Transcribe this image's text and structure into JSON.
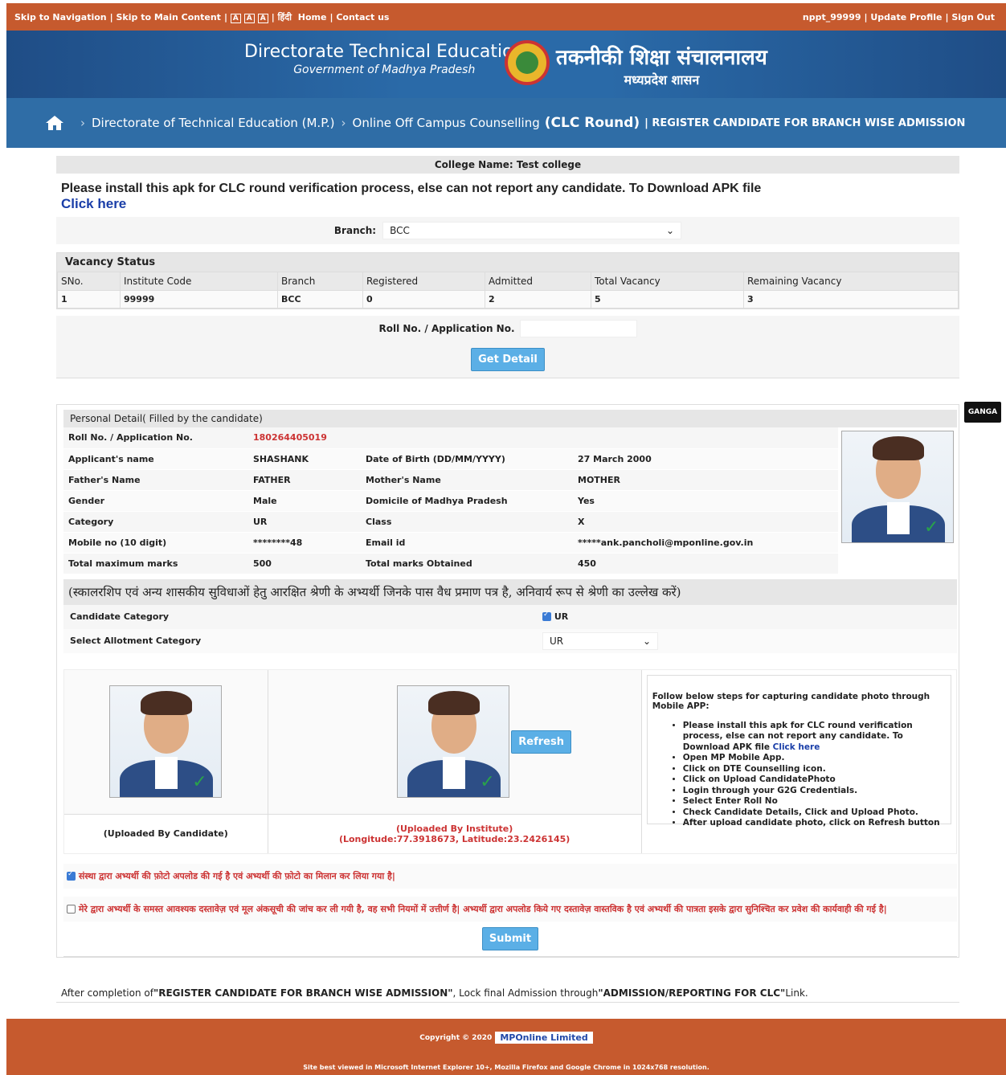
{
  "topbar": {
    "skip_nav": "Skip to Navigation",
    "skip_main": "Skip to Main Content",
    "font_a1": "A",
    "font_a2": "A",
    "font_a3": "A",
    "hindi": "हिंदी",
    "home": "Home",
    "contact": "Contact us",
    "user": "nppt_99999",
    "update_profile": "Update Profile",
    "sign_out": "Sign Out"
  },
  "banner": {
    "title_en": "Directorate Technical Education",
    "subtitle_en": "Government of Madhya Pradesh",
    "title_hi": "तकनीकी शिक्षा संचालनालय",
    "subtitle_hi": "मध्यप्रदेश शासन"
  },
  "breadcrumb": {
    "item1": "Directorate of Technical Education (M.P.)",
    "item2": "Online Off Campus Counselling",
    "round": "(CLC Round)",
    "page": "| REGISTER CANDIDATE FOR BRANCH WISE ADMISSION"
  },
  "college": {
    "label": "College Name: Test college"
  },
  "notice": {
    "text": "Please install this apk for CLC round verification process, else can not report any candidate. To Download APK file",
    "link": "Click here"
  },
  "branch": {
    "label": "Branch:",
    "value": "BCC"
  },
  "vacancy": {
    "title": "Vacancy Status",
    "headers": [
      "SNo.",
      "Institute Code",
      "Branch",
      "Registered",
      "Admitted",
      "Total Vacancy",
      "Remaining Vacancy"
    ],
    "row": [
      "1",
      "99999",
      "BCC",
      "0",
      "2",
      "5",
      "3"
    ]
  },
  "roll": {
    "label": "Roll No. / Application No.",
    "button": "Get Detail"
  },
  "personal": {
    "title": "Personal Detail( Filled by the candidate)",
    "roll_label": "Roll No. / Application No.",
    "roll_value": "180264405019",
    "name_label": "Applicant's name",
    "name_value": "SHASHANK",
    "dob_label": "Date of Birth (DD/MM/YYYY)",
    "dob_value": "27 March 2000",
    "father_label": "Father's Name",
    "father_value": "FATHER",
    "mother_label": "Mother's Name",
    "mother_value": "MOTHER",
    "gender_label": "Gender",
    "gender_value": "Male",
    "domicile_label": "Domicile of Madhya Pradesh",
    "domicile_value": "Yes",
    "category_label": "Category",
    "category_value": "UR",
    "class_label": "Class",
    "class_value": "X",
    "mobile_label": "Mobile no (10 digit)",
    "mobile_value": "********48",
    "email_label": "Email id",
    "email_value": "*****ank.pancholi@mponline.gov.in",
    "maxmarks_label": "Total maximum marks",
    "maxmarks_value": "500",
    "obtained_label": "Total marks Obtained",
    "obtained_value": "450"
  },
  "category_section": {
    "hindi_note": "(स्कालरशिप एवं अन्य शासकीय सुविधाओं हेतु आरक्षित श्रेणी के अभ्यर्थी जिनके पास वैध प्रमाण पत्र है, अनिवार्य रूप से श्रेणी का उल्लेख करें)",
    "candidate_category_label": "Candidate Category",
    "candidate_category_value": "UR",
    "allotment_label": "Select Allotment Category",
    "allotment_value": "UR"
  },
  "photos": {
    "candidate_caption": "(Uploaded By Candidate)",
    "refresh": "Refresh",
    "institute_caption": "(Uploaded By Institute)",
    "coords": "(Longitude:77.3918673, Latitude:23.2426145)",
    "steps_title": "Follow below steps for capturing candidate photo through Mobile APP:",
    "step1": "Please install this apk for CLC round verification process, else can not report any candidate. To Download APK file",
    "step1_link": "Click here",
    "steps": [
      "Open MP Mobile App.",
      "Click on DTE Counselling icon.",
      "Click on Upload CandidatePhoto",
      "Login through your G2G Credentials.",
      "Select Enter Roll No",
      "Check Candidate Details, Click and Upload Photo.",
      "After upload candidate photo, click on Refresh button"
    ]
  },
  "declaration": {
    "line1": "संस्था द्वारा अभ्यर्थी की फ़ोटो अपलोड की गई है एवं अभ्यर्थी की फ़ोटो का मिलान कर लिया गया है|",
    "line2": "मेरे द्वारा अभ्यर्थी के समस्त आवश्यक दस्तावेज़ एवं मूल अंकसूची की जांच कर ली गयी है, वह सभी नियमों में उत्तीर्ण है| अभ्यर्थी द्वारा अपलोड किये गए दस्तावेज़ वास्तविक है एवं अभ्यर्थी की पात्रता इसके द्वारा सुनिश्चित कर प्रवेश की कार्यवाही की गई है|",
    "submit": "Submit"
  },
  "after_note": {
    "p1": "After completion of ",
    "q1": "\"REGISTER CANDIDATE FOR BRANCH WISE ADMISSION\"",
    "p2": ", Lock final Admission through ",
    "q2": "\"ADMISSION/REPORTING FOR CLC\"",
    "p3": " Link."
  },
  "footer": {
    "copyright": "Copyright © 2020",
    "logo": "MPOnline Limited",
    "best_viewed": "Site best viewed in Microsoft Internet Explorer 10+, Mozilla Firefox and Google Chrome in 1024x768 resolution."
  },
  "side_tag": "GANGA"
}
